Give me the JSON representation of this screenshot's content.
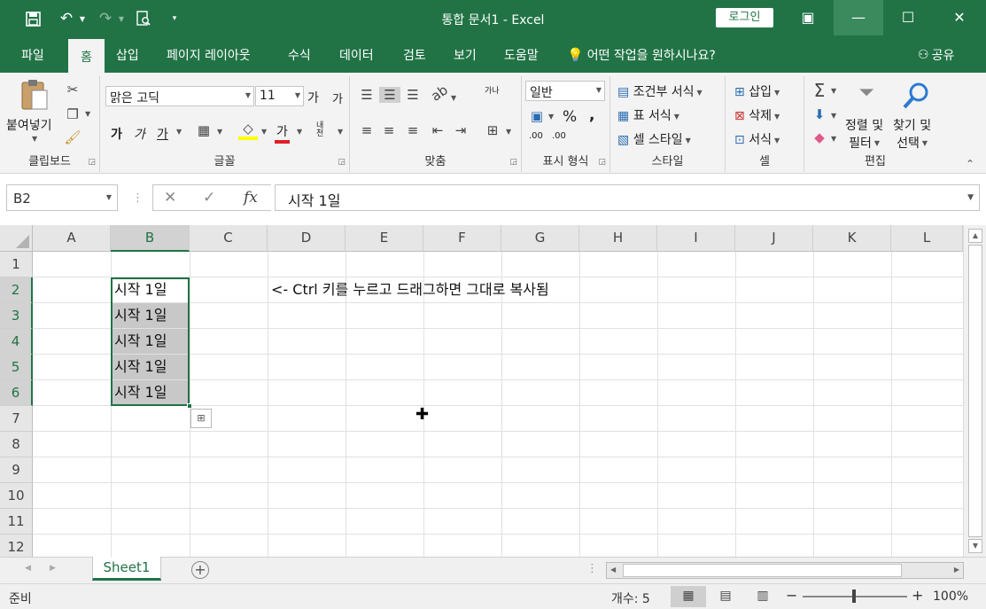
{
  "titlebar": {
    "title": "통합 문서1  -  Excel",
    "login_label": "로그인",
    "save_icon": "save-icon",
    "undo_icon": "undo-icon",
    "redo_icon": "redo-icon",
    "print_preview_icon": "print-preview-icon",
    "window_controls": {
      "restore_ribbon": "▣",
      "minimize": "—",
      "maximize": "☐",
      "close": "✕"
    }
  },
  "tabs": [
    "파일",
    "홈",
    "삽입",
    "페이지 레이아웃",
    "수식",
    "데이터",
    "검토",
    "보기",
    "도움말"
  ],
  "active_tab": "홈",
  "tell_me": "어떤 작업을 원하시나요?",
  "share_label": "공유",
  "ribbon": {
    "clipboard": {
      "label": "클립보드",
      "paste": "붙여넣기"
    },
    "font": {
      "label": "글꼴",
      "font_name": "맑은 고딕",
      "font_size": "11",
      "grow": "가",
      "shrink": "가",
      "bold": "가",
      "italic": "가",
      "underline": "가",
      "font_color_glyph": "가",
      "phonetic": "내천"
    },
    "alignment": {
      "label": "맞춤",
      "wrap_glyph": "가나"
    },
    "number": {
      "label": "표시 형식",
      "format": "일반",
      "percent": "%",
      "comma": ",",
      "inc_decimal": ".00",
      "dec_decimal": ".00"
    },
    "styles": {
      "label": "스타일",
      "conditional": "조건부 서식",
      "table": "표 서식",
      "cell_styles": "셀 스타일"
    },
    "cells": {
      "label": "셀",
      "insert": "삽입",
      "delete": "삭제",
      "format": "서식"
    },
    "editing": {
      "label": "편집",
      "sort_line1": "정렬 및",
      "sort_line2": "필터",
      "find_line1": "찾기 및",
      "find_line2": "선택"
    }
  },
  "formula_bar": {
    "name_box": "B2",
    "fx": "fx",
    "content": "시작 1일"
  },
  "grid": {
    "columns": [
      "A",
      "B",
      "C",
      "D",
      "E",
      "F",
      "G",
      "H",
      "I",
      "J",
      "K",
      "L"
    ],
    "rows": [
      "1",
      "2",
      "3",
      "4",
      "5",
      "6",
      "7",
      "8",
      "9",
      "10",
      "11",
      "12"
    ],
    "cells": {
      "B2": "시작 1일",
      "B3": "시작 1일",
      "B4": "시작 1일",
      "B5": "시작 1일",
      "B6": "시작 1일",
      "D2": "<- Ctrl 키를 누르고 드래그하면 그대로 복사됨"
    },
    "selected_column": "B",
    "selected_rows": [
      "2",
      "3",
      "4",
      "5",
      "6"
    ]
  },
  "sheets": [
    "Sheet1"
  ],
  "status": {
    "ready": "준비",
    "count": "개수: 5",
    "zoom": "100%"
  },
  "colors": {
    "accent": "#217346",
    "selection_fill": "#c8c8c8"
  }
}
